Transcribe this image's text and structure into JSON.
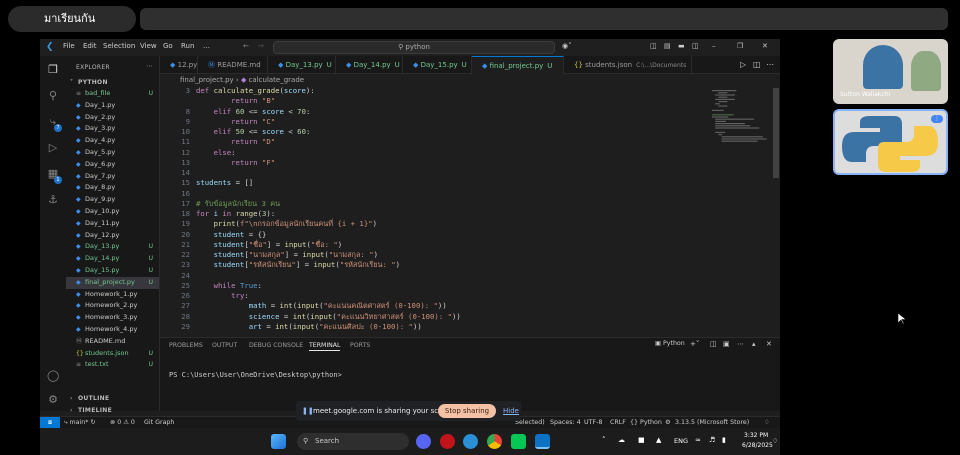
{
  "meet": {
    "title": "มาเรียนกัน",
    "participant1_name": "Sutton Wallakchi",
    "sharing_message": "meet.google.com is sharing your screen.",
    "stop_label": "Stop sharing",
    "hide_label": "Hide"
  },
  "vscode": {
    "menu": [
      "File",
      "Edit",
      "Selection",
      "View",
      "Go",
      "Run",
      "…"
    ],
    "search_placeholder": "python",
    "sidebar": {
      "explorer_label": "EXPLORER",
      "folder_label": "PYTHON",
      "files": [
        {
          "name": "bad_file",
          "git": "U"
        },
        {
          "name": "Day_1.py",
          "git": ""
        },
        {
          "name": "Day_2.py",
          "git": ""
        },
        {
          "name": "Day_3.py",
          "git": ""
        },
        {
          "name": "Day_4.py",
          "git": ""
        },
        {
          "name": "Day_5.py",
          "git": ""
        },
        {
          "name": "Day_6.py",
          "git": ""
        },
        {
          "name": "Day_7.py",
          "git": ""
        },
        {
          "name": "Day_8.py",
          "git": ""
        },
        {
          "name": "Day_9.py",
          "git": ""
        },
        {
          "name": "Day_10.py",
          "git": ""
        },
        {
          "name": "Day_11.py",
          "git": ""
        },
        {
          "name": "Day_12.py",
          "git": ""
        },
        {
          "name": "Day_13.py",
          "git": "U"
        },
        {
          "name": "Day_14.py",
          "git": "U"
        },
        {
          "name": "Day_15.py",
          "git": "U"
        },
        {
          "name": "final_project.py",
          "git": "U"
        },
        {
          "name": "Homework_1.py",
          "git": ""
        },
        {
          "name": "Homework_2.py",
          "git": ""
        },
        {
          "name": "Homework_3.py",
          "git": ""
        },
        {
          "name": "Homework_4.py",
          "git": ""
        },
        {
          "name": "README.md",
          "git": ""
        },
        {
          "name": "students.json",
          "git": "U"
        },
        {
          "name": "test.txt",
          "git": "U"
        }
      ],
      "outline_label": "OUTLINE",
      "timeline_label": "TIMELINE"
    },
    "tabs": [
      {
        "label": "12.py",
        "mark": ""
      },
      {
        "label": "README.md",
        "mark": ""
      },
      {
        "label": "Day_13.py",
        "mark": "U"
      },
      {
        "label": "Day_14.py",
        "mark": "U"
      },
      {
        "label": "Day_15.py",
        "mark": "U"
      },
      {
        "label": "final_project.py",
        "mark": "U"
      },
      {
        "label": "students.json",
        "mark": "C:\\...\\Documents"
      }
    ],
    "breadcrumbs": {
      "file": "final_project.py",
      "symbol": "calculate_grade"
    },
    "code": [
      {
        "n": "3",
        "t": "def calculate_grade(score):"
      },
      {
        "n": "",
        "t": "        return \"B\""
      },
      {
        "n": "8",
        "t": "    elif 60 <= score < 70:"
      },
      {
        "n": "9",
        "t": "        return \"C\""
      },
      {
        "n": "10",
        "t": "    elif 50 <= score < 60:"
      },
      {
        "n": "11",
        "t": "        return \"D\""
      },
      {
        "n": "12",
        "t": "    else:"
      },
      {
        "n": "13",
        "t": "        return \"F\""
      },
      {
        "n": "14",
        "t": ""
      },
      {
        "n": "15",
        "t": "students = []"
      },
      {
        "n": "16",
        "t": ""
      },
      {
        "n": "17",
        "t": "# รับข้อมูลนักเรียน 3 คน"
      },
      {
        "n": "18",
        "t": "for i in range(3):"
      },
      {
        "n": "19",
        "t": "    print(f\"\\nกรอกข้อมูลนักเรียนคนที่ {i + 1}\")"
      },
      {
        "n": "20",
        "t": "    student = {}"
      },
      {
        "n": "21",
        "t": "    student[\"ชื่อ\"] = input(\"ชื่อ: \")"
      },
      {
        "n": "22",
        "t": "    student[\"นามสกุล\"] = input(\"นามสกุล: \")"
      },
      {
        "n": "23",
        "t": "    student[\"รหัสนักเรียน\"] = input(\"รหัสนักเรียน: \")"
      },
      {
        "n": "24",
        "t": ""
      },
      {
        "n": "25",
        "t": "    while True:"
      },
      {
        "n": "26",
        "t": "        try:"
      },
      {
        "n": "27",
        "t": "            math = int(input(\"คะแนนคณิตศาสตร์ (0-100): \"))"
      },
      {
        "n": "28",
        "t": "            science = int(input(\"คะแนนวิทยาศาสตร์ (0-100): \"))"
      },
      {
        "n": "29",
        "t": "            art = int(input(\"คะแนนศิลปะ (0-100): \"))"
      }
    ],
    "panel": {
      "tabs": [
        "PROBLEMS",
        "OUTPUT",
        "DEBUG CONSOLE",
        "TERMINAL",
        "PORTS"
      ],
      "active_tab": "TERMINAL",
      "terminal_shell": "Python",
      "prompt": "PS C:\\Users\\User\\OneDrive\\Desktop\\python>"
    },
    "status": {
      "branch": "main*",
      "problems": "⊗ 0 ⚠ 0",
      "git_graph": "Git Graph",
      "selected": "Selected)",
      "spaces": "Spaces: 4",
      "encoding": "UTF-8",
      "eol": "CRLF",
      "language": "Python",
      "interpreter": "3.13.5 (Microsoft Store)"
    }
  },
  "taskbar": {
    "search_label": "Search",
    "lang": "ENG",
    "time": "3:32 PM",
    "date": "6/28/2025"
  }
}
